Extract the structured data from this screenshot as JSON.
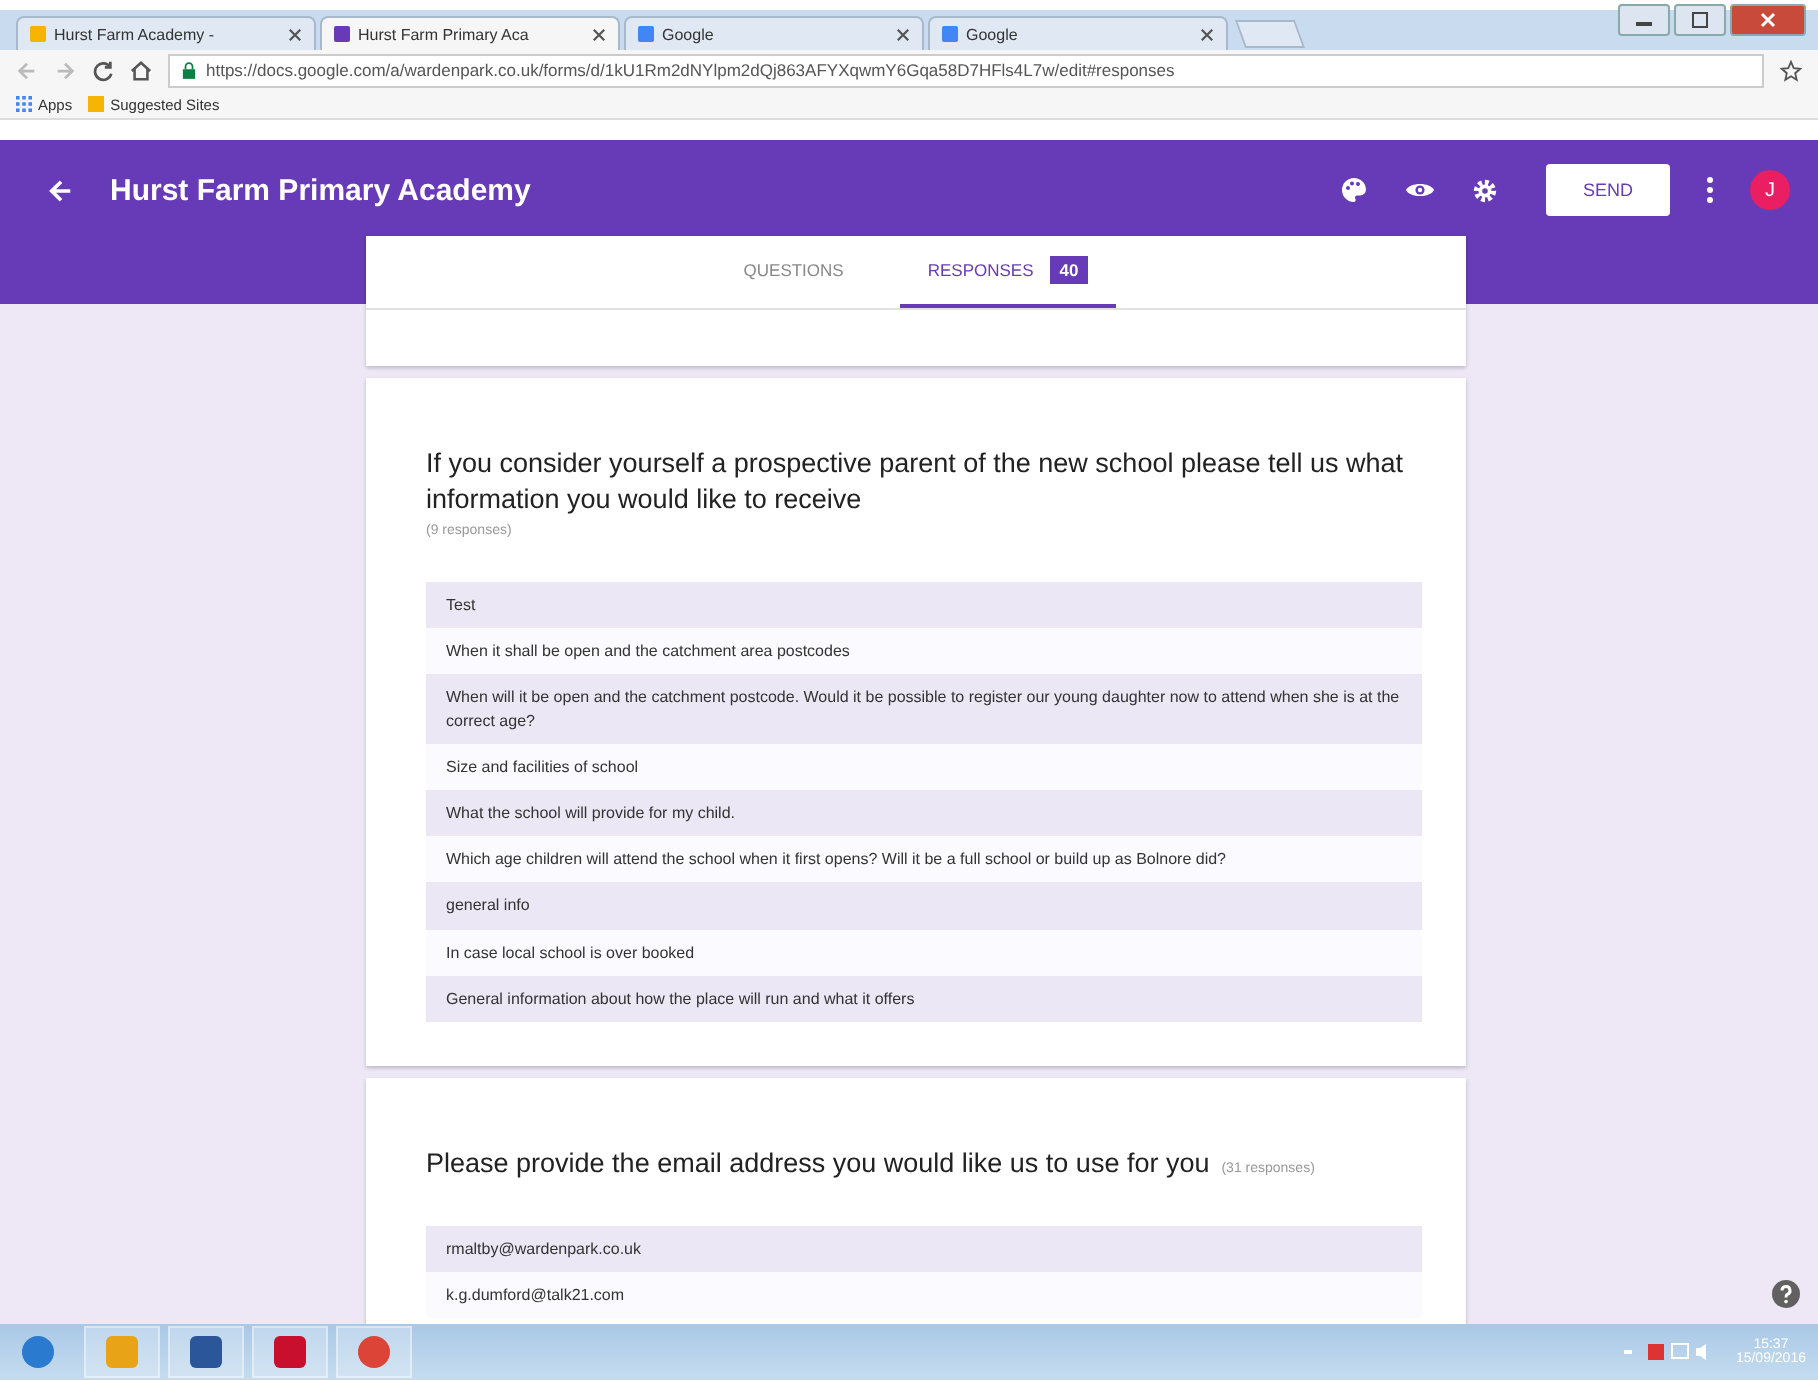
{
  "browser": {
    "tabs": [
      {
        "title": "Hurst Farm Academy - ",
        "selected": false
      },
      {
        "title": "Hurst Farm Primary Aca",
        "selected": true
      },
      {
        "title": "Google",
        "selected": false
      },
      {
        "title": "Google",
        "selected": false
      }
    ],
    "url": "https://docs.google.com/a/wardenpark.co.uk/forms/d/1kU1Rm2dNYlpm2dQj863AFYXqwmY6Gqa58D7HFls4L7w/edit#responses",
    "bookmarks": [
      "Apps",
      "Suggested Sites"
    ]
  },
  "form": {
    "title": "Hurst Farm Primary Academy",
    "send": "SEND",
    "avatar": "J",
    "tabs": [
      {
        "label": "QUESTIONS",
        "selected": false
      },
      {
        "label": "RESPONSES",
        "count": "40",
        "selected": true
      }
    ]
  },
  "questions": [
    {
      "title": "If you consider yourself a prospective parent of the new school please tell us what information you would like to receive",
      "responses": "(9 responses)",
      "answers": [
        "Test",
        "When it shall be open and the catchment area postcodes",
        "When will it be open and the catchment postcode. Would it be possible to register our young daughter now to attend when she is at the correct age?",
        "Size and facilities of school",
        "What the school will provide for my child.",
        "Which age children will attend the school when it first opens? Will it be a full school or build up as Bolnore did?",
        "general info",
        "In case local school is over booked",
        "General information about how the place will run and what it offers"
      ]
    },
    {
      "title": "Please provide the email address you would like us to use for you",
      "responses": "(31 responses)",
      "answers": [
        "rmaltby@wardenpark.co.uk",
        "k.g.dumford@talk21.com"
      ]
    }
  ],
  "taskbar": {
    "time": "15:37",
    "date": "15/09/2016"
  }
}
